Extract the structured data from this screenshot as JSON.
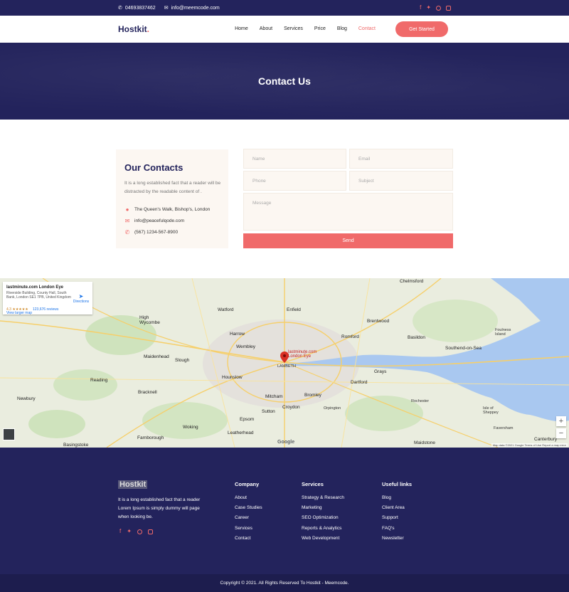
{
  "topbar": {
    "phone": "04693837462",
    "email": "info@meemcode.com",
    "social_icons": [
      "facebook-icon",
      "twitter-icon",
      "pinterest-icon",
      "instagram-icon"
    ]
  },
  "header": {
    "logo": "Hostkit",
    "logo_dot": ".",
    "nav": [
      "Home",
      "About",
      "Services",
      "Price",
      "Blog",
      "Contact"
    ],
    "active_nav": "Contact",
    "cta_label": "Get Started"
  },
  "banner": {
    "title": "Contact Us"
  },
  "contacts": {
    "title": "Our Contacts",
    "description": "It is a long established fact that a reader will be distracted by the readable content of .",
    "address": "The Queen's Walk, Bishop's, London",
    "email": "info@peacefulqode.com",
    "phone": "(567) 1234-567-8900"
  },
  "form": {
    "name_placeholder": "Name",
    "email_placeholder": "Email",
    "phone_placeholder": "Phone",
    "subject_placeholder": "Subject",
    "message_placeholder": "Message",
    "send_label": "Send"
  },
  "map": {
    "place_title": "lastminute.com London Eye",
    "place_address": "Riverside Building, County Hall, South Bank, London SE1 7PB, United Kingdom",
    "rating": "4.3 ★★★★★",
    "reviews": "123,676 reviews",
    "larger_map": "View larger map",
    "directions": "Directions",
    "pin_label_1": "lastminute.com",
    "pin_label_2": "London Eye",
    "attribution": "Map data ©2021 Google   Terms of Use   Report a map error",
    "google": "Google",
    "zoom_in": "+",
    "zoom_out": "−",
    "cities": {
      "chelmsford": "Chelmsford",
      "watford": "Watford",
      "enfield": "Enfield",
      "brentwood": "Brentwood",
      "harrow": "Harrow",
      "romford": "Romford",
      "basildon": "Basildon",
      "southend": "Southend-on-Sea",
      "slough": "Slough",
      "maidenhead": "Maidenhead",
      "wembley": "Wembley",
      "hounslow": "Hounslow",
      "reading": "Reading",
      "bracknell": "Bracknell",
      "mitcham": "Mitcham",
      "croydon": "Croydon",
      "bromley": "Bromley",
      "dartford": "Dartford",
      "grays": "Grays",
      "sutton": "Sutton",
      "epsom": "Epsom",
      "woking": "Woking",
      "leatherhead": "Leatherhead",
      "orpington": "Orpington",
      "rochester": "Rochester",
      "maidstone": "Maidstone",
      "canterbury": "Canterbury",
      "high_wycombe": "High Wycombe",
      "newbury": "Newbury",
      "basingstoke": "Basingstoke",
      "farnborough": "Farnborough",
      "lambeth": "LAMBETH",
      "sheppey": "Isle of Sheppey",
      "faversham": "Faversham",
      "foulness": "Foulness Island"
    }
  },
  "footer": {
    "logo": "Hostkit",
    "description": "It is a long established fact that a reader Lorem Ipsum is simply dummy will page when looking be.",
    "company_title": "Company",
    "company_links": [
      "About",
      "Case Studies",
      "Career",
      "Services",
      "Contact"
    ],
    "services_title": "Services",
    "services_links": [
      "Strategy & Research",
      "Marketing",
      "SEO Optimization",
      "Reports & Analytics",
      "Web Development"
    ],
    "useful_title": "Useful links",
    "useful_links": [
      "Blog",
      "Client Area",
      "Support",
      "FAQ's",
      "Newsletter"
    ],
    "copyright": "Copyright © 2021. All Rights Reserved To Hostkit - Meemcode."
  },
  "colors": {
    "navy": "#23235c",
    "accent": "#f06a6a",
    "card_bg": "#fcf7f2"
  }
}
